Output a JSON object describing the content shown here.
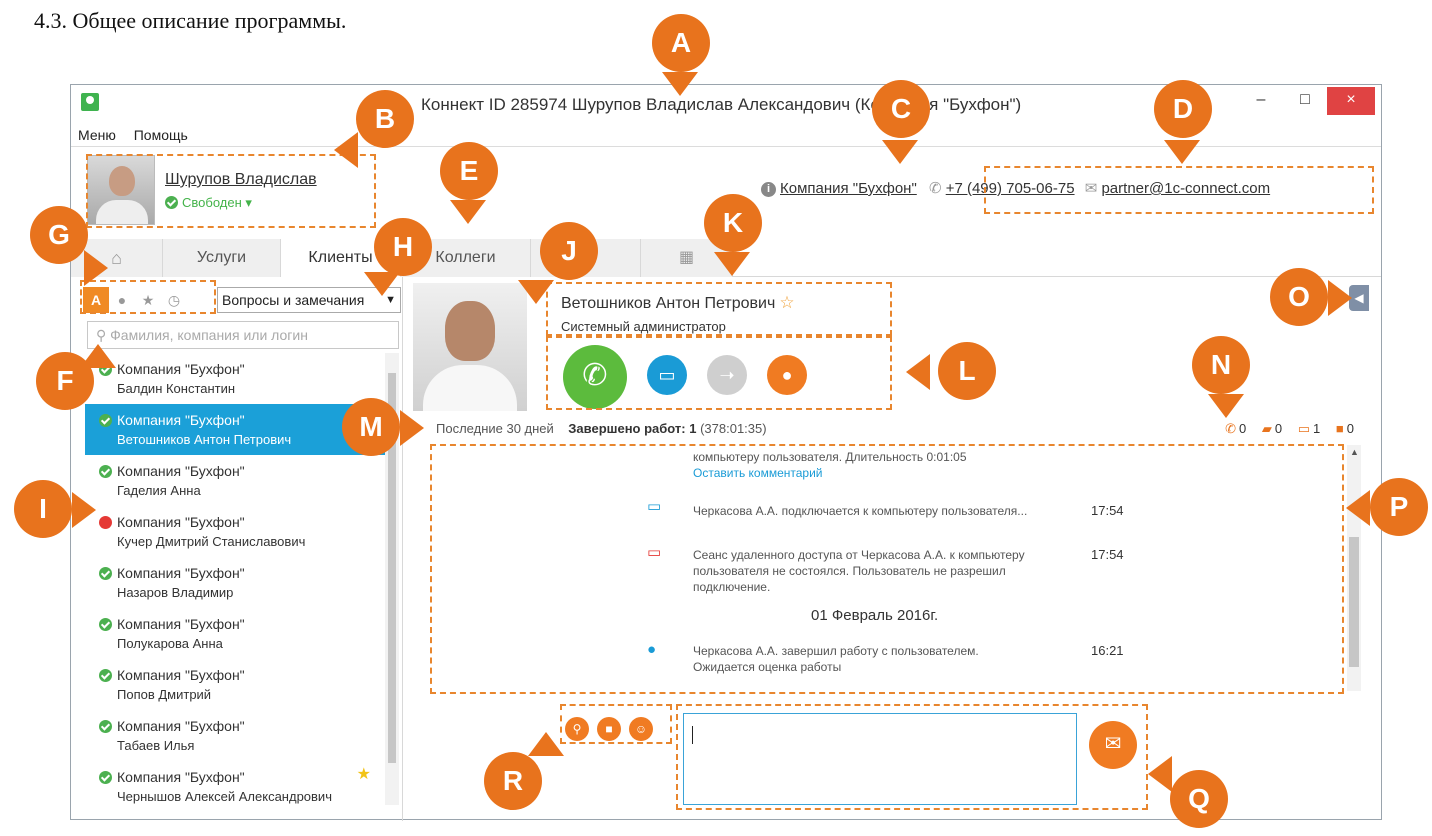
{
  "doc": {
    "heading": "4.3. Общее описание программы."
  },
  "window": {
    "title": "Коннект ID 285974 Шурупов Владислав Александович (Компания \"Бухфон\")",
    "minimize": "–",
    "maximize": "□",
    "close": "×"
  },
  "menu": {
    "items": [
      "Меню",
      "Помощь"
    ]
  },
  "profile": {
    "name": "Шурупов Владислав",
    "status": "Свободен ▾"
  },
  "company_bar": {
    "company": "Компания \"Бухфон\"",
    "phone": "+7 (499) 705-06-75",
    "email": "partner@1c-connect.com"
  },
  "tabs": {
    "home_icon": "home-icon",
    "services": "Услуги",
    "clients": "Клиенты",
    "colleagues": "Коллеги",
    "grid_icon": "grid-icon"
  },
  "filters": {
    "alpha": "A",
    "select": "Вопросы и замечания",
    "search_placeholder": "Фамилия, компания или логин"
  },
  "contacts": [
    {
      "company": "Компания \"Бухфон\"",
      "name": "Балдин Константин",
      "status": "online"
    },
    {
      "company": "Компания \"Бухфон\"",
      "name": "Ветошников Антон Петрович",
      "status": "online"
    },
    {
      "company": "Компания \"Бухфон\"",
      "name": "Гаделия Анна",
      "status": "online"
    },
    {
      "company": "Компания \"Бухфон\"",
      "name": "Кучер Дмитрий Станиславович",
      "status": "busy"
    },
    {
      "company": "Компания \"Бухфон\"",
      "name": "Назаров Владимир",
      "status": "online"
    },
    {
      "company": "Компания \"Бухфон\"",
      "name": "Полукарова Анна",
      "status": "online"
    },
    {
      "company": "Компания \"Бухфон\"",
      "name": "Попов Дмитрий",
      "status": "online"
    },
    {
      "company": "Компания \"Бухфон\"",
      "name": "Табаев Илья",
      "status": "online"
    },
    {
      "company": "Компания \"Бухфон\"",
      "name": "Чернышов Алексей Александрович",
      "status": "online"
    }
  ],
  "selected_person": {
    "name": "Ветошников Антон Петрович",
    "role": "Системный администратор"
  },
  "summary": {
    "period": "Последние 30 дней",
    "done_label": "Завершено работ: 1",
    "done_time": "(378:01:35)",
    "counters": {
      "calls": "0",
      "chats": "0",
      "remote": "1",
      "saved": "0"
    }
  },
  "log": {
    "entry1": "компьютеру пользователя. Длительность 0:01:05",
    "entry1_link": "Оставить комментарий",
    "entry2": "Черкасова А.А. подключается к компьютеру пользователя...",
    "entry2_time": "17:54",
    "entry3": "Сеанс удаленного доступа от Черкасова А.А. к компьютеру пользователя не состоялся. Пользователь не разрешил подключение.",
    "entry3_time": "17:54",
    "date": "01 Февраль 2016г.",
    "entry4": "Черкасова А.А. завершил работу с пользователем. Ожидается оценка работы",
    "entry4_time": "16:21"
  },
  "markers": [
    "A",
    "B",
    "C",
    "D",
    "E",
    "F",
    "G",
    "H",
    "I",
    "J",
    "K",
    "L",
    "M",
    "N",
    "O",
    "P",
    "Q",
    "R"
  ],
  "colors": {
    "accent": "#e8731d",
    "selected": "#1ba0d8",
    "online": "#4cb050",
    "call": "#5cbb3d"
  }
}
